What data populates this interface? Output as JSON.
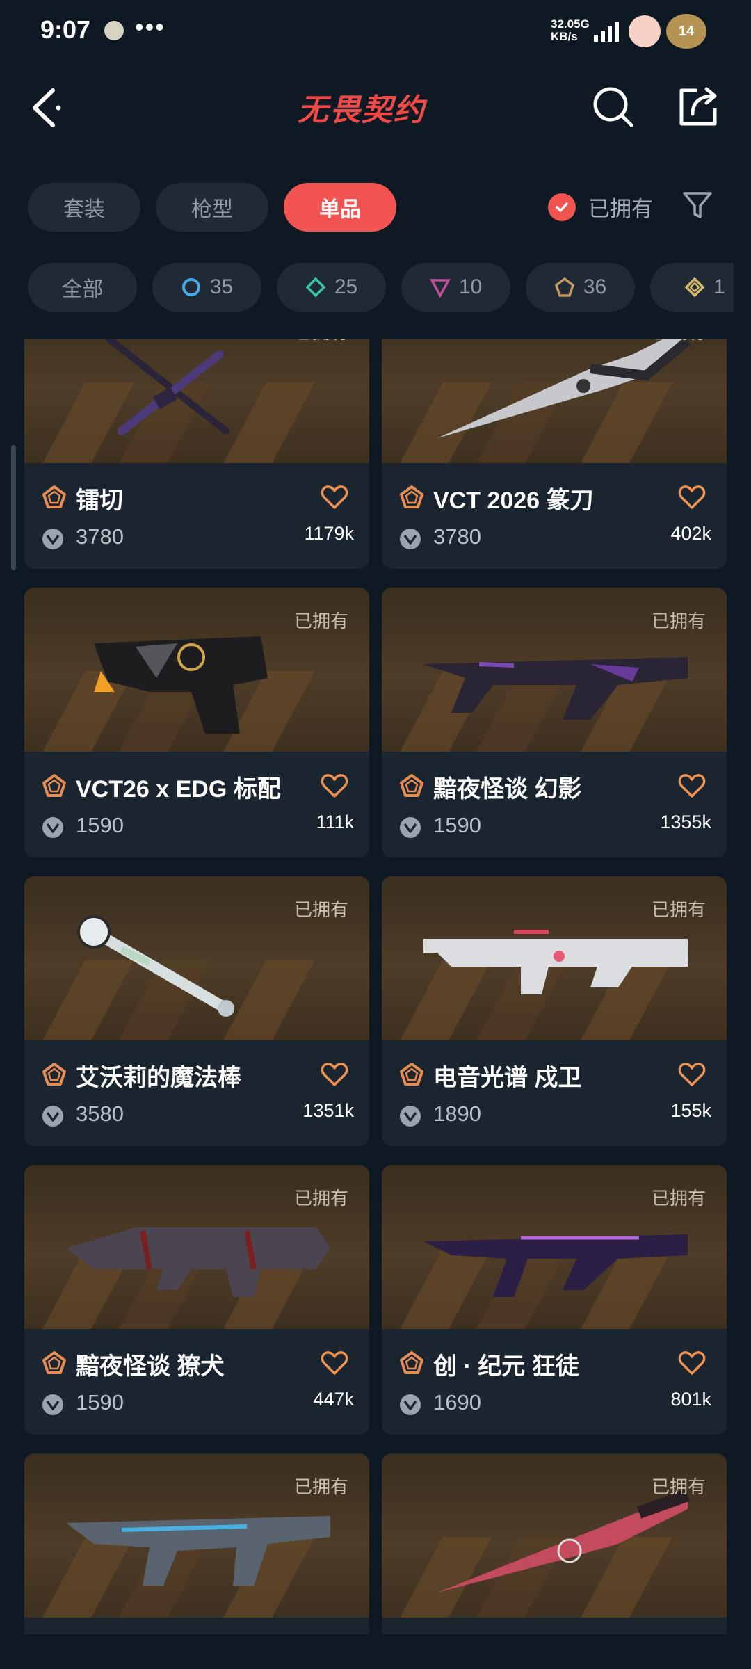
{
  "status_bar": {
    "time": "9:07",
    "more": "•••",
    "speed_value": "32.0",
    "speed_unit": "KB/s",
    "network": "5G",
    "battery": "14"
  },
  "header": {
    "logo_text": "无畏契约"
  },
  "tabs": [
    {
      "label": "套装",
      "active": false
    },
    {
      "label": "枪型",
      "active": false
    },
    {
      "label": "单品",
      "active": true
    }
  ],
  "owned_filter": {
    "label": "已拥有",
    "checked": true
  },
  "tiers": [
    {
      "label": "全部",
      "color": ""
    },
    {
      "label": "35",
      "color": "#4aa9e8"
    },
    {
      "label": "25",
      "color": "#3cc5a4"
    },
    {
      "label": "10",
      "color": "#c04f9c"
    },
    {
      "label": "36",
      "color": "#c89a64"
    },
    {
      "label": "1",
      "color": "#d5b86a"
    }
  ],
  "items": [
    {
      "name": "镭切",
      "price": "3780",
      "likes": "1179k",
      "owned": "已拥有",
      "weapon": "katana"
    },
    {
      "name": "VCT 2026 篆刀",
      "price": "3780",
      "likes": "402k",
      "owned": "已拥有",
      "weapon": "knife"
    },
    {
      "name": "VCT26 x EDG 标配",
      "price": "1590",
      "likes": "111k",
      "owned": "已拥有",
      "weapon": "pistol"
    },
    {
      "name": "黯夜怪谈 幻影",
      "price": "1590",
      "likes": "1355k",
      "owned": "已拥有",
      "weapon": "rifle-dark"
    },
    {
      "name": "艾沃莉的魔法棒",
      "price": "3580",
      "likes": "1351k",
      "owned": "已拥有",
      "weapon": "wand"
    },
    {
      "name": "电音光谱 戍卫",
      "price": "1890",
      "likes": "155k",
      "owned": "已拥有",
      "weapon": "rifle-white"
    },
    {
      "name": "黯夜怪谈 獠犬",
      "price": "1590",
      "likes": "447k",
      "owned": "已拥有",
      "weapon": "smg-dark"
    },
    {
      "name": "创 · 纪元 狂徒",
      "price": "1690",
      "likes": "801k",
      "owned": "已拥有",
      "weapon": "rifle-purple"
    },
    {
      "name": "",
      "price": "",
      "likes": "",
      "owned": "已拥有",
      "weapon": "smg-steel"
    },
    {
      "name": "",
      "price": "",
      "likes": "",
      "owned": "已拥有",
      "weapon": "knife-red"
    }
  ],
  "colors": {
    "accent": "#f25451",
    "background": "#0f1923",
    "card": "#1a2530",
    "tier_icon": "#e58d55",
    "heart": "#f09250"
  }
}
